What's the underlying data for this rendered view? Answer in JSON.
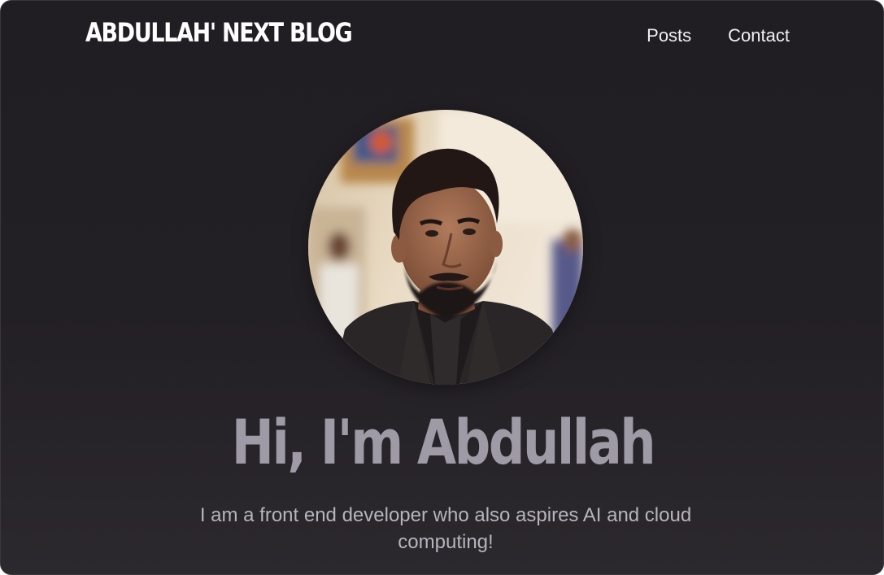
{
  "site": {
    "logo_text": "ABDULLAH' NEXT BLOG"
  },
  "nav": {
    "items": [
      {
        "label": "Posts"
      },
      {
        "label": "Contact"
      }
    ]
  },
  "hero": {
    "title": "Hi, I'm Abdullah",
    "subtitle": "I am a front end developer who also aspires AI and cloud computing!"
  },
  "colors": {
    "background_top": "#201e22",
    "background_bottom": "#2b282e",
    "logo": "#ffffff",
    "nav_text": "#f1eff3",
    "title": "#9e9ba7",
    "subtitle": "#b7b4bd"
  },
  "icons": {
    "profile_image": "portrait-photo"
  }
}
